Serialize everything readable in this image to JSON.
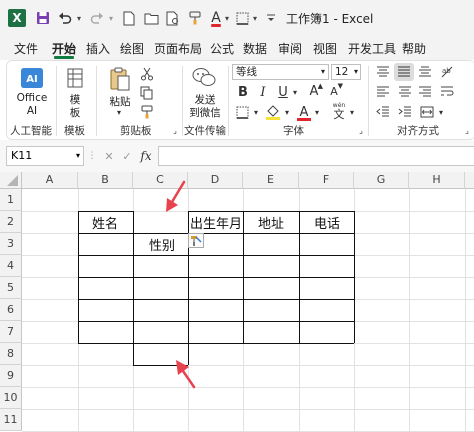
{
  "window": {
    "title": "工作簿1 - Excel"
  },
  "menu": {
    "tabs": [
      "文件",
      "开始",
      "插入",
      "绘图",
      "页面布局",
      "公式",
      "数据",
      "审阅",
      "视图",
      "开发工具",
      "帮助"
    ],
    "active": "开始"
  },
  "ribbon": {
    "ai": {
      "button_label_1": "Office",
      "button_label_2": "AI",
      "group": "人工智能"
    },
    "template": {
      "button_label_1": "模",
      "button_label_2": "板",
      "group": "模板"
    },
    "clipboard": {
      "paste_label": "粘贴",
      "group": "剪贴板"
    },
    "file_transfer": {
      "button_label_1": "发送",
      "button_label_2": "到微信",
      "group": "文件传输"
    },
    "font": {
      "name": "等线",
      "size": "12",
      "group": "字体",
      "bold": "B",
      "italic": "I",
      "underline": "U",
      "font_color_glyph": "A",
      "wen": "wén",
      "wen_char": "文"
    },
    "alignment": {
      "group": "对齐方式"
    }
  },
  "formula_bar": {
    "name_box": "K11",
    "fx": "fx",
    "cancel": "✕",
    "enter": "✓",
    "formula": ""
  },
  "sheet": {
    "columns": [
      "A",
      "B",
      "C",
      "D",
      "E",
      "F",
      "G",
      "H"
    ],
    "rows": [
      "1",
      "2",
      "3",
      "4",
      "5",
      "6",
      "7",
      "8",
      "9",
      "10",
      "11"
    ],
    "cells": {
      "B2": "姓名",
      "D2": "出生年月",
      "E2": "地址",
      "F2": "电话",
      "C3": "性别"
    }
  },
  "colors": {
    "accent": "#107c41",
    "arrow": "#e8424f",
    "title_bar": "#f3f3f3"
  },
  "icons": [
    "excel-logo-icon",
    "save-icon",
    "undo-icon",
    "redo-icon",
    "new-file-icon",
    "open-folder-icon",
    "print-preview-icon",
    "format-painter-icon",
    "font-color-icon",
    "borders-icon",
    "customize-icon",
    "paste-icon",
    "cut-icon",
    "copy-icon",
    "wechat-icon",
    "align-icons",
    "paste-options-icon",
    "annotation-arrow-icon"
  ]
}
